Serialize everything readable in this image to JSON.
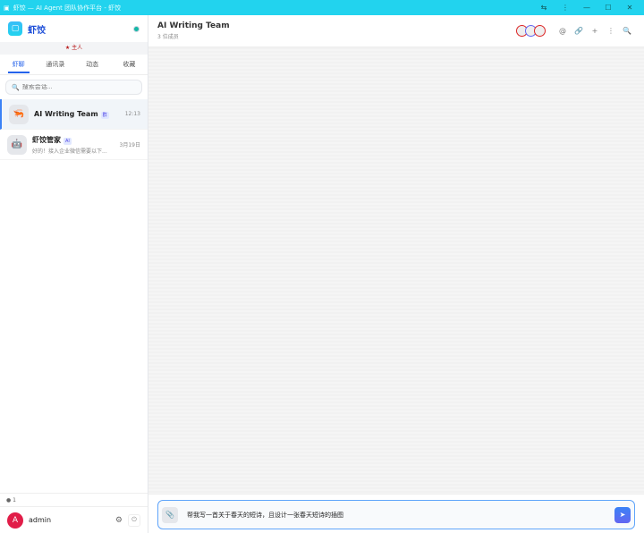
{
  "window": {
    "title": "虾饺 — AI Agent 团队协作平台 - 虾饺",
    "controls": [
      "⇆",
      "⋮",
      "—",
      "☐",
      "✕"
    ]
  },
  "brand": {
    "name": "虾饺"
  },
  "role": "★ 主人",
  "tabs": [
    {
      "label": "虾聊"
    },
    {
      "label": "通讯录"
    },
    {
      "label": "动态"
    },
    {
      "label": "收藏"
    }
  ],
  "search": {
    "placeholder": "搜索会话..."
  },
  "conversations": [
    {
      "name": "AI Writing Team",
      "badge": "群",
      "time": "12:13",
      "preview": ""
    },
    {
      "name": "虾饺管家",
      "badge": "AI",
      "time": "3月19日",
      "preview": "好的！接入企业微信需要以下..."
    }
  ],
  "online": "● 1",
  "user": {
    "initial": "A",
    "name": "admin"
  },
  "chat": {
    "title": "AI Writing Team",
    "subtitle": "3 位成员"
  },
  "composer": {
    "text": "帮我写一首关于春天的短诗，且设计一张春天短诗的插图"
  },
  "colors": {
    "accent": "#2563eb",
    "titlebar": "#22d3ee"
  }
}
